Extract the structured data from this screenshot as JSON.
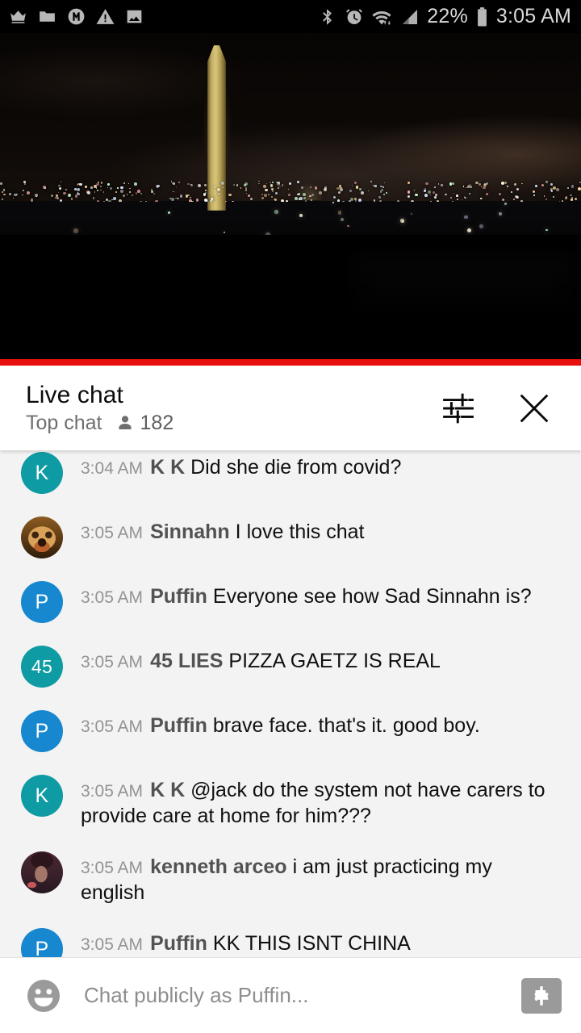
{
  "status_bar": {
    "left_icons": [
      "crown-icon",
      "folder-icon",
      "m-circle-icon",
      "warning-triangle-icon",
      "image-icon"
    ],
    "right_icons": [
      "bluetooth-icon",
      "alarm-icon",
      "wifi-icon",
      "cellular-signal-icon",
      "battery-icon"
    ],
    "battery_percent": "22%",
    "clock": "3:05 AM"
  },
  "video": {
    "scene_description": "night-skyline-washington-monument",
    "progress_color": "#e8100e"
  },
  "chat_header": {
    "title": "Live chat",
    "mode": "Top chat",
    "viewer_icon": "person-icon",
    "viewer_count": "182",
    "settings_icon": "tune-sliders-icon",
    "close_icon": "close-x-icon"
  },
  "messages": [
    {
      "time": "3:04 AM",
      "author": "K K",
      "text": "Did she die from covid?",
      "avatar_type": "initials",
      "avatar_initials": "K",
      "avatar_color": "#0e9ba4"
    },
    {
      "time": "3:05 AM",
      "author": "Sinnahn",
      "text": "I love this chat",
      "avatar_type": "photo-lion",
      "avatar_initials": "",
      "avatar_color": "#8c5a21"
    },
    {
      "time": "3:05 AM",
      "author": "Puffin",
      "text": "Everyone see how Sad Sinnahn is?",
      "avatar_type": "initials",
      "avatar_initials": "P",
      "avatar_color": "#1787cf"
    },
    {
      "time": "3:05 AM",
      "author": "45 LIES",
      "text": "PIZZA GAETZ IS REAL",
      "avatar_type": "initials",
      "avatar_initials": "45",
      "avatar_color": "#0e9ba4"
    },
    {
      "time": "3:05 AM",
      "author": "Puffin",
      "text": "brave face. that's it. good boy.",
      "avatar_type": "initials",
      "avatar_initials": "P",
      "avatar_color": "#1787cf"
    },
    {
      "time": "3:05 AM",
      "author": "K K",
      "text": "@jack do the system not have carers to provide care at home for him???",
      "avatar_type": "initials",
      "avatar_initials": "K",
      "avatar_color": "#0e9ba4"
    },
    {
      "time": "3:05 AM",
      "author": "kenneth arceo",
      "text": "i am just practicing my english",
      "avatar_type": "photo-person",
      "avatar_initials": "",
      "avatar_color": "#4a2731"
    },
    {
      "time": "3:05 AM",
      "author": "Puffin",
      "text": "KK THIS ISNT CHINA",
      "avatar_type": "initials",
      "avatar_initials": "P",
      "avatar_color": "#1787cf"
    }
  ],
  "input_bar": {
    "emoji_icon": "emoji-smiley-icon",
    "placeholder": "Chat publicly as Puffin...",
    "superchat_icon": "dollar-sign-icon"
  }
}
